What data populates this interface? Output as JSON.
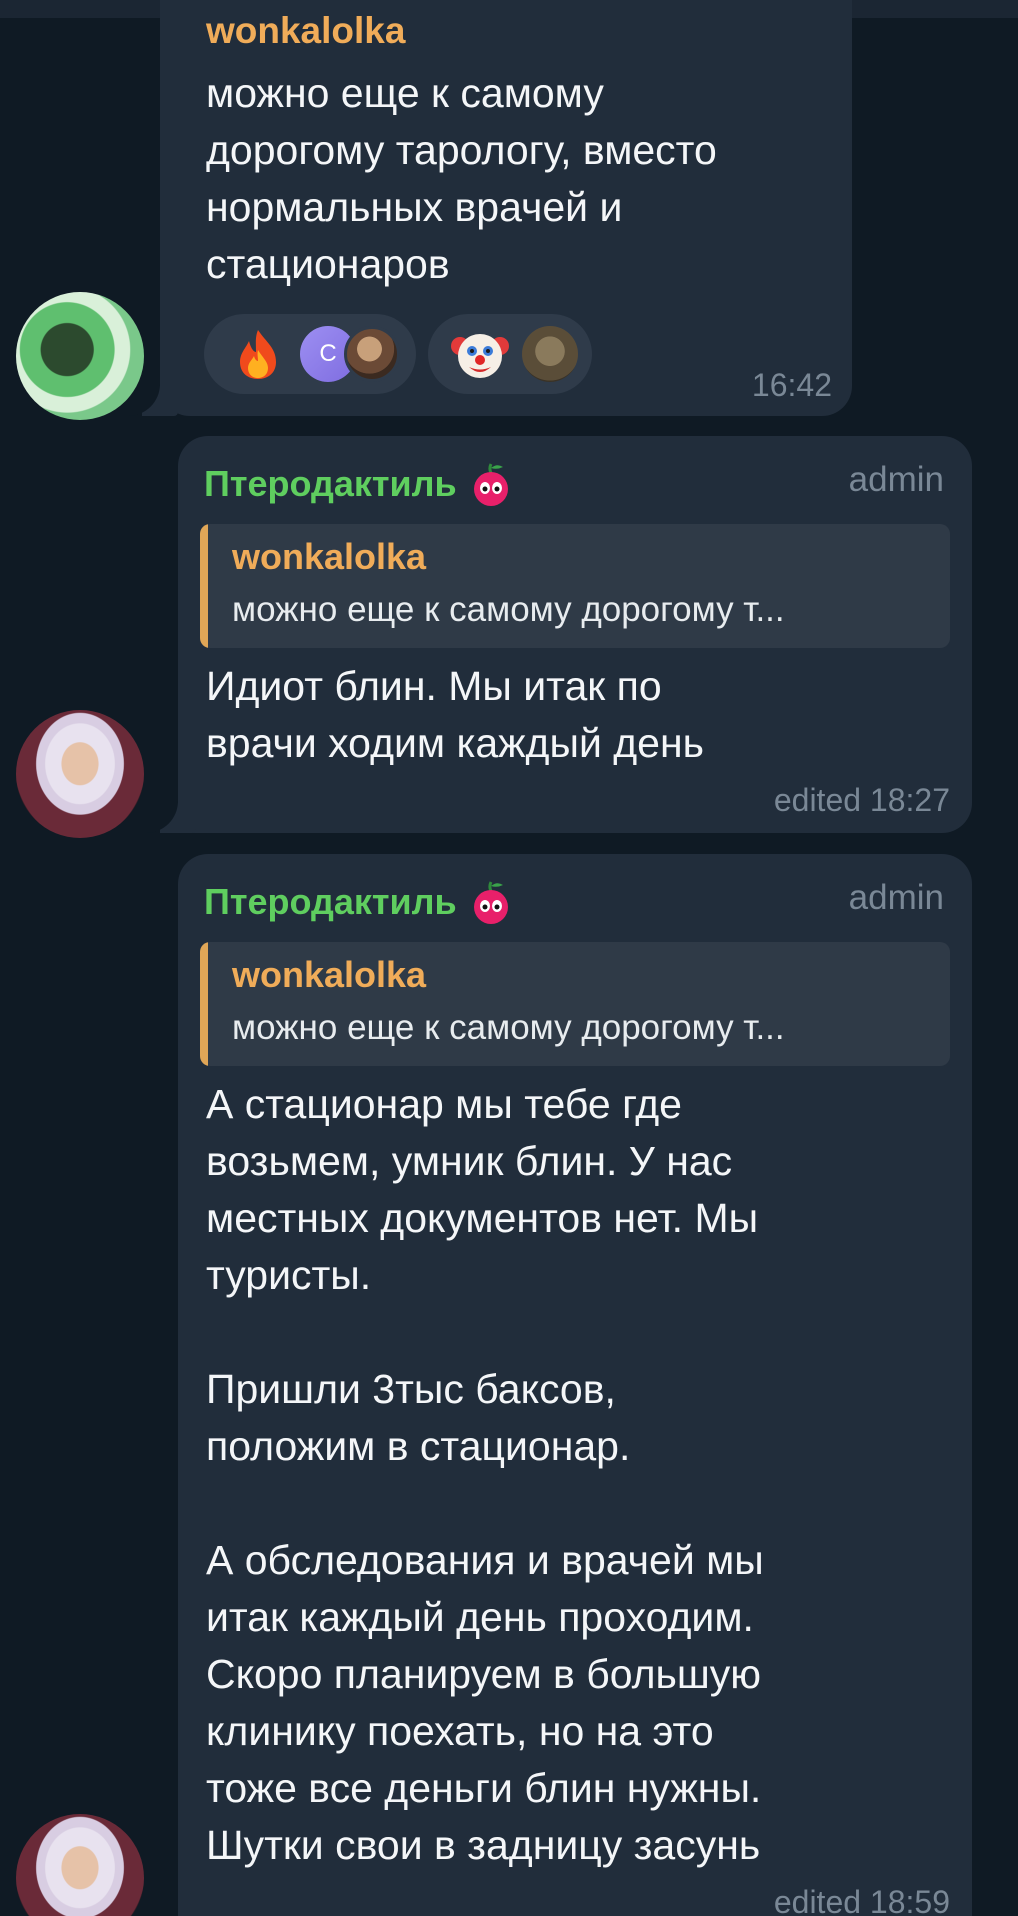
{
  "messages": [
    {
      "sender": "wonkalolka",
      "text": "можно еще к самому\nдорогому тарологу, вместо\nнормальных врачей и\nстационаров",
      "time": "16:42",
      "reactions": [
        {
          "emoji": "🔥",
          "avatars": [
            "C",
            "portrait"
          ]
        },
        {
          "emoji": "🤡",
          "avatars": [
            "creature"
          ]
        }
      ]
    },
    {
      "sender": "Птеродактиль",
      "role": "admin",
      "reply": {
        "name": "wonkalolka",
        "text": "можно еще к самому дорогому т..."
      },
      "text": "Идиот блин. Мы итак по\nврачи ходим каждый день",
      "time": "edited 18:27"
    },
    {
      "sender": "Птеродактиль",
      "role": "admin",
      "reply": {
        "name": "wonkalolka",
        "text": "можно еще к самому дорогому т..."
      },
      "text": "А стационар мы тебе где\nвозьмем, умник блин. У нас\nместных документов нет. Мы\nтуристы.\n\nПришли 3тыс баксов,\nположим в стационар.\n\nА обследования и врачей мы\nитак каждый день проходим.\nСкоро планируем в большую\nклинику поехать, но на это\nтоже все деньги блин нужны.\nШутки свои в задницу засунь",
      "time": "edited 18:59"
    }
  ],
  "colors": {
    "background": "#0f1a24",
    "bubble": "#212d3b",
    "sender_admin": "#5fce5f",
    "reply_name": "#f0ac59",
    "reply_bar": "#e0a657"
  },
  "icons": [
    "fire-emoji",
    "clown-emoji",
    "cherry-emoji"
  ]
}
